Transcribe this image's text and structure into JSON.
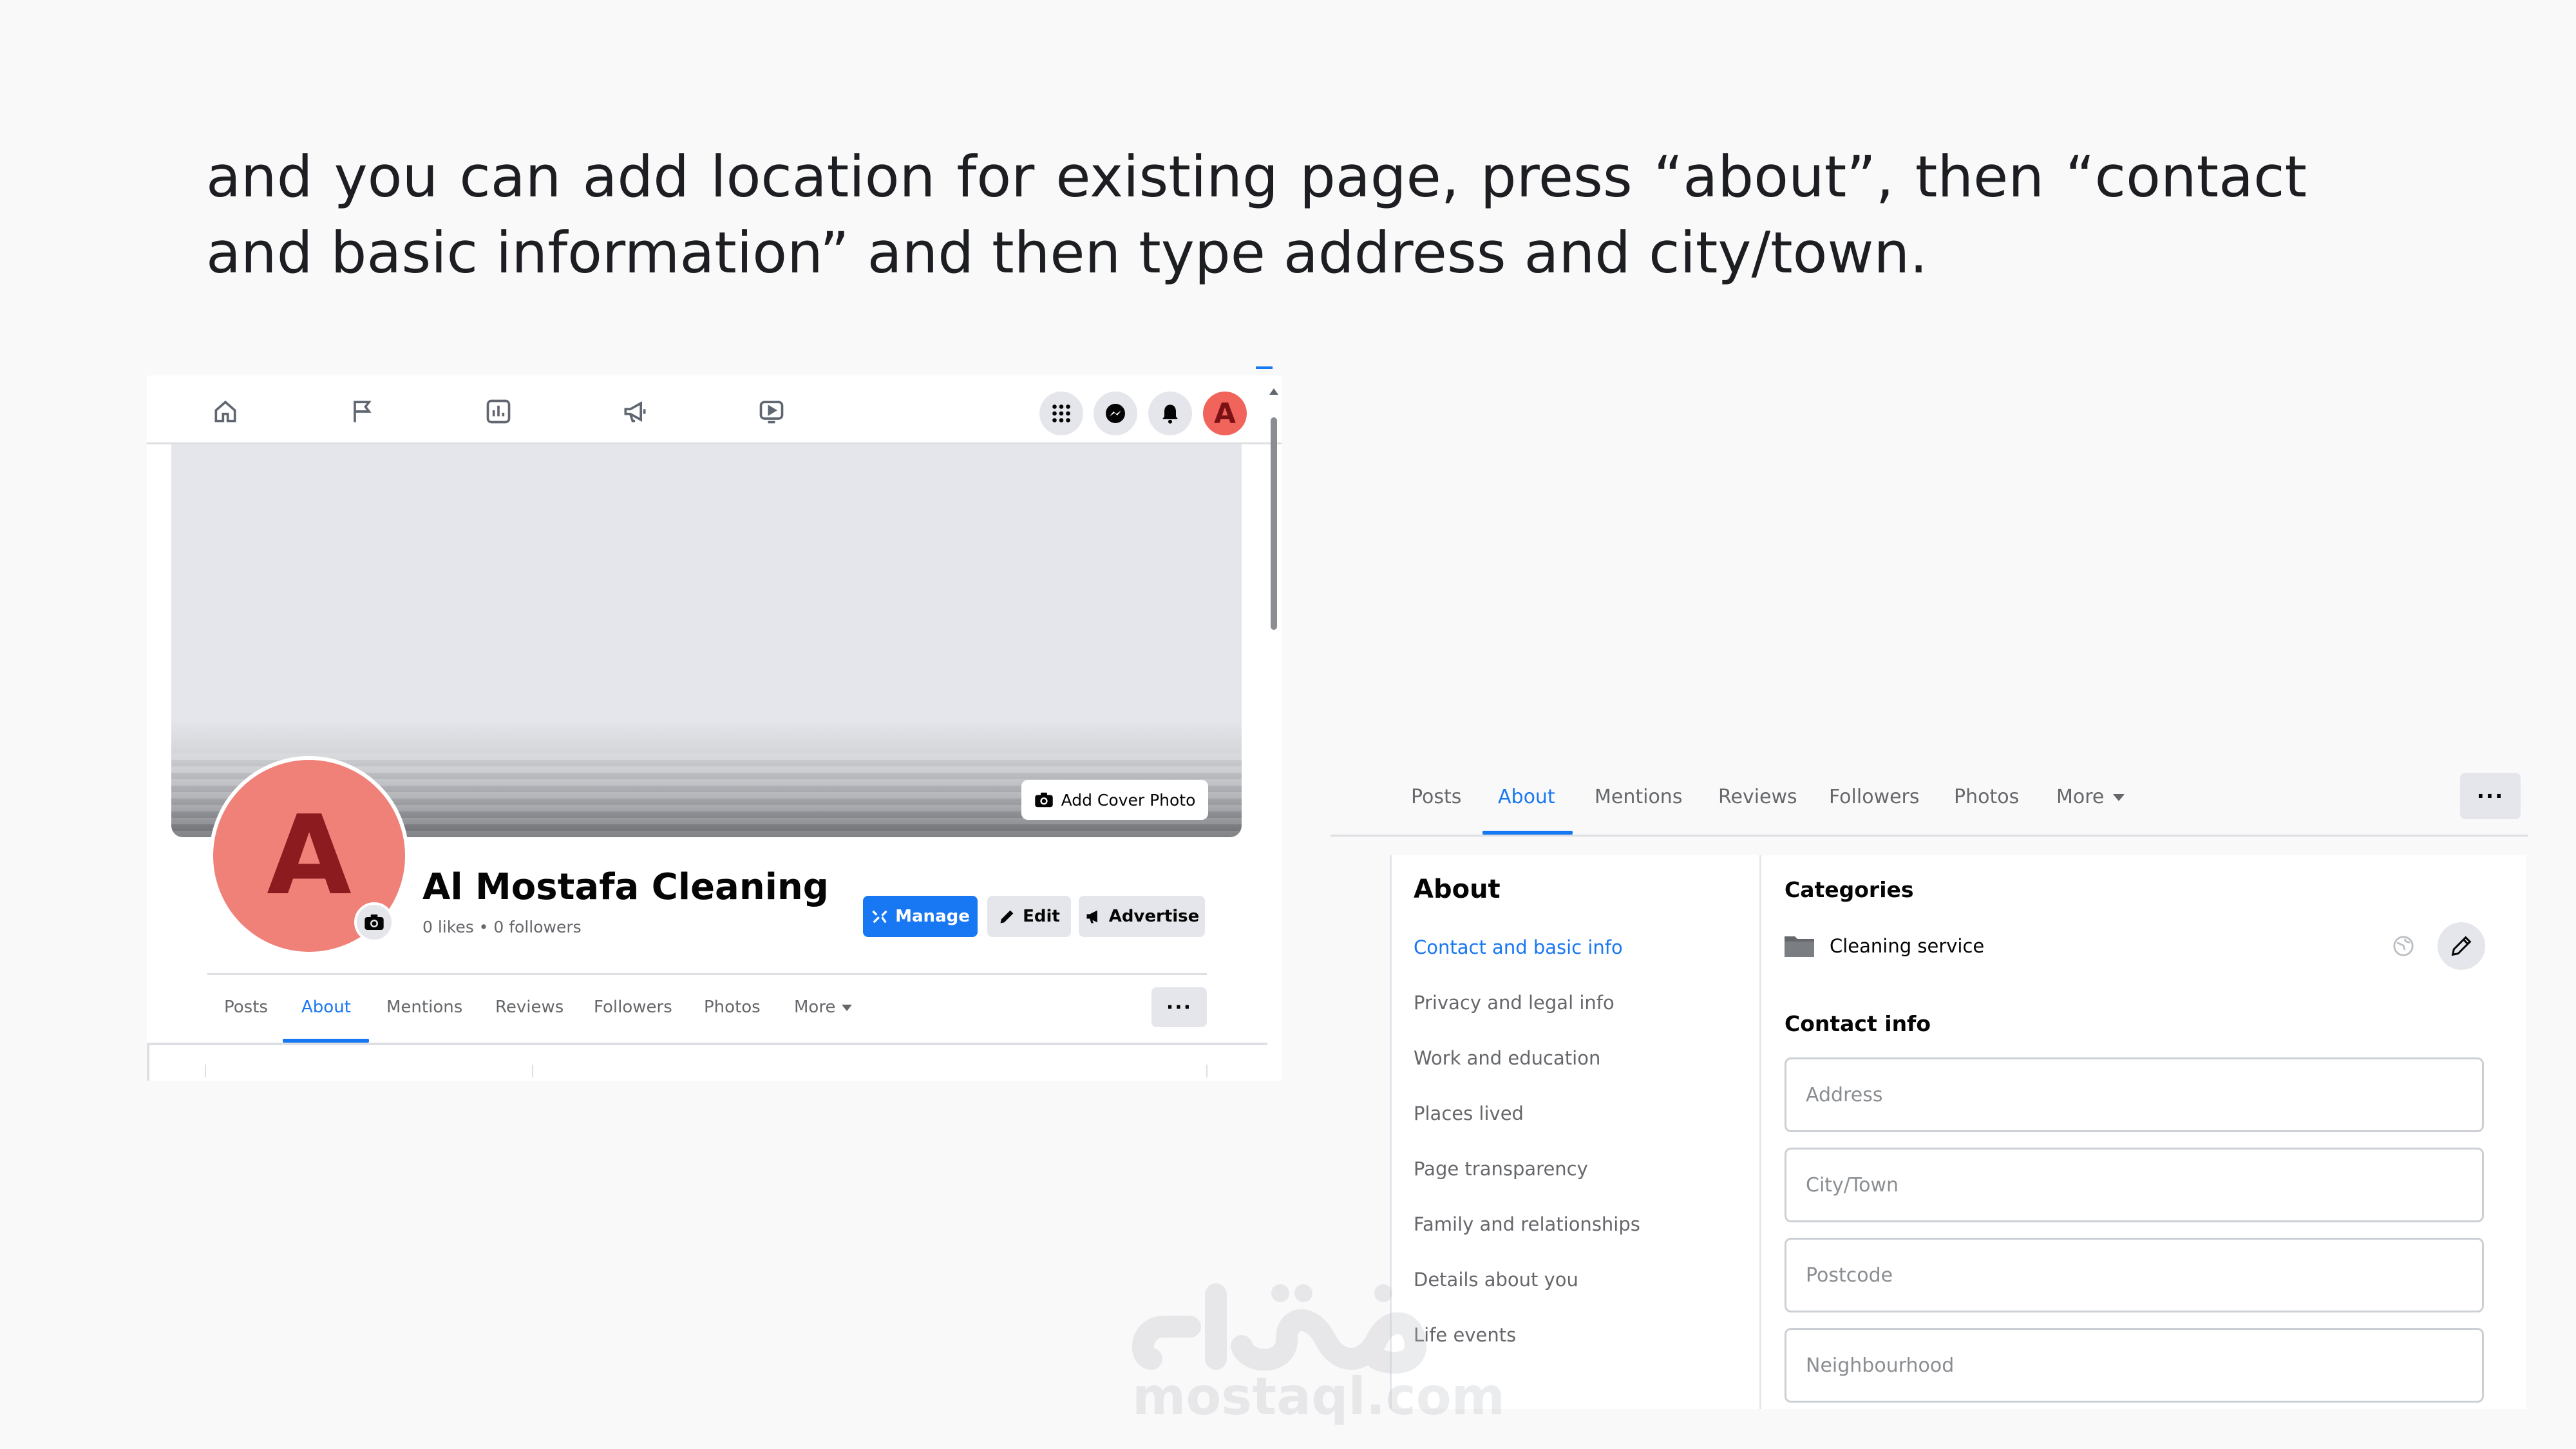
{
  "instruction": "and you can add location for existing page, press “about”, then “contact and basic information”  and then type address and city/town.",
  "left_screenshot": {
    "topnav": {
      "icons": [
        "home-icon",
        "flag-icon",
        "insights-icon",
        "megaphone-icon",
        "video-icon"
      ],
      "right_icons": [
        "menu-grid-icon",
        "messenger-icon",
        "bell-icon"
      ],
      "avatar_letter": "A"
    },
    "cover": {
      "add_cover_label": "Add Cover Photo"
    },
    "profile": {
      "letter": "A",
      "name": "Al Mostafa Cleaning",
      "stats": "0 likes • 0 followers"
    },
    "actions": {
      "manage": "Manage",
      "edit": "Edit",
      "advertise": "Advertise"
    },
    "tabs": {
      "posts": "Posts",
      "about": "About",
      "mentions": "Mentions",
      "reviews": "Reviews",
      "followers": "Followers",
      "photos": "Photos",
      "more": "More",
      "dots": "···"
    }
  },
  "right_screenshot": {
    "tabs": {
      "posts": "Posts",
      "about": "About",
      "mentions": "Mentions",
      "reviews": "Reviews",
      "followers": "Followers",
      "photos": "Photos",
      "more": "More",
      "dots": "···"
    },
    "about_menu": {
      "heading": "About",
      "items": [
        "Contact and basic info",
        "Privacy and legal info",
        "Work and education",
        "Places lived",
        "Page transparency",
        "Family and relationships",
        "Details about you",
        "Life events"
      ],
      "active_index": 0
    },
    "details": {
      "categories_heading": "Categories",
      "category": "Cleaning service",
      "contact_heading": "Contact info",
      "fields": {
        "address_placeholder": "Address",
        "city_placeholder": "City/Town",
        "postcode_placeholder": "Postcode",
        "neighbourhood_placeholder": "Neighbourhood"
      }
    }
  },
  "watermark": {
    "latin": "mostaql.com"
  },
  "colors": {
    "accent": "#1877f2",
    "avatar": "#f0645c",
    "muted": "#65676b"
  }
}
